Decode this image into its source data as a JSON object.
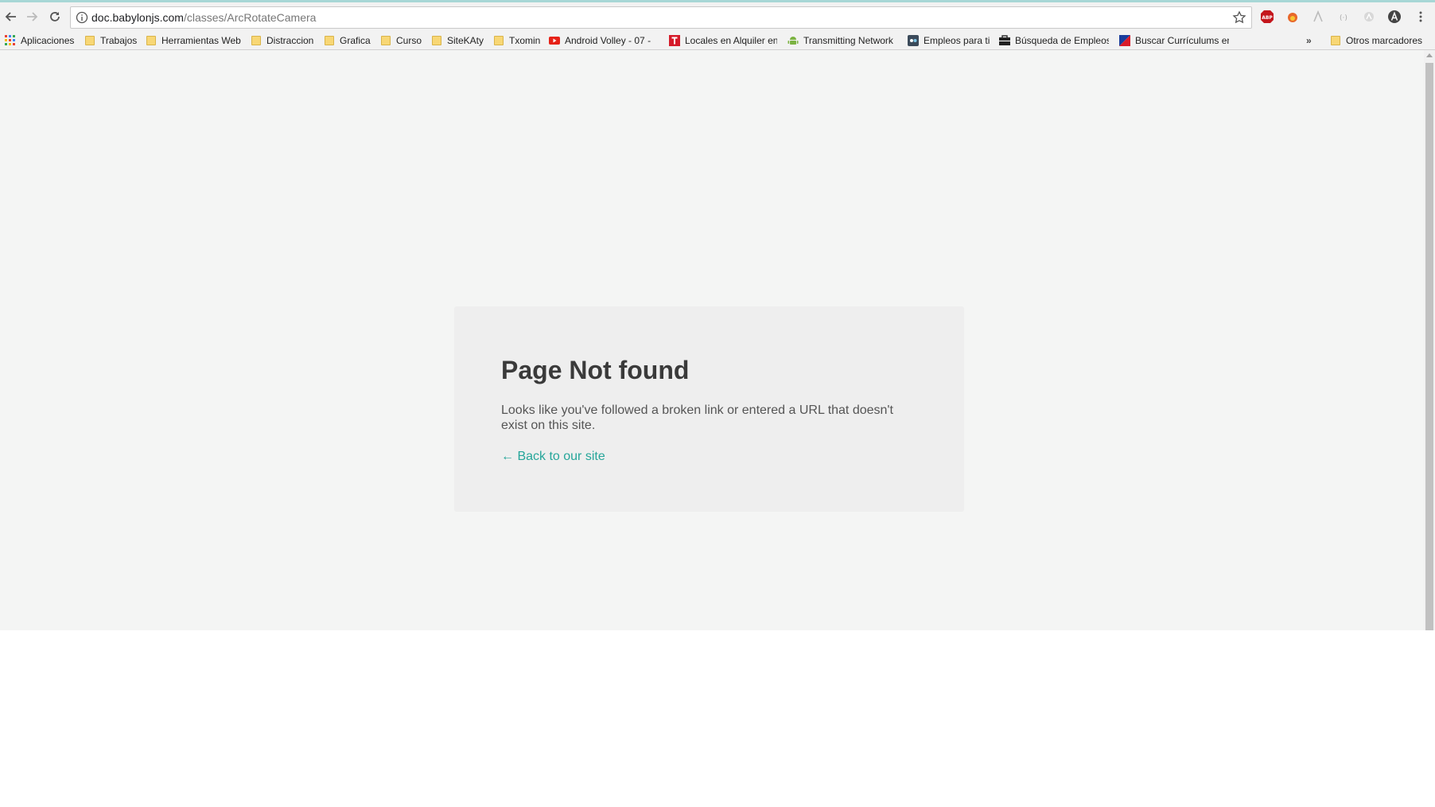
{
  "browser": {
    "url_host": "doc.babylonjs.com",
    "url_path": "/classes/ArcRotateCamera",
    "extensions": [
      "ABP",
      "extension-icon",
      "pdf-icon",
      "broadcast-icon",
      "extension-icon",
      "A"
    ]
  },
  "bookmarks": [
    {
      "label": "Aplicaciones",
      "icon": "apps-grid-icon"
    },
    {
      "label": "Trabajos",
      "icon": "folder-icon"
    },
    {
      "label": "Herramientas Web",
      "icon": "folder-icon"
    },
    {
      "label": "Distraccion",
      "icon": "folder-icon"
    },
    {
      "label": "Grafica",
      "icon": "folder-icon"
    },
    {
      "label": "Curso",
      "icon": "folder-icon"
    },
    {
      "label": "SiteKAty",
      "icon": "folder-icon"
    },
    {
      "label": "Txomin",
      "icon": "folder-icon"
    },
    {
      "label": "Android Volley - 07 -",
      "icon": "youtube-icon"
    },
    {
      "label": "Locales en Alquiler en",
      "icon": "t-logo-icon"
    },
    {
      "label": "Transmitting Network",
      "icon": "android-icon"
    },
    {
      "label": "Empleos para ti",
      "icon": "site-icon"
    },
    {
      "label": "Búsqueda de Empleos",
      "icon": "briefcase-icon"
    },
    {
      "label": "Buscar Currículums en",
      "icon": "flag-icon"
    }
  ],
  "bookmarks_overflow": "»",
  "other_bookmarks": "Otros marcadores",
  "content": {
    "title": "Page Not found",
    "message": "Looks like you've followed a broken link or entered a URL that doesn't exist on this site.",
    "back_link": "← Back to our site"
  },
  "colors": {
    "accent": "#26a69a",
    "page_bg": "#f4f5f4",
    "card_bg": "#eeeeee"
  }
}
